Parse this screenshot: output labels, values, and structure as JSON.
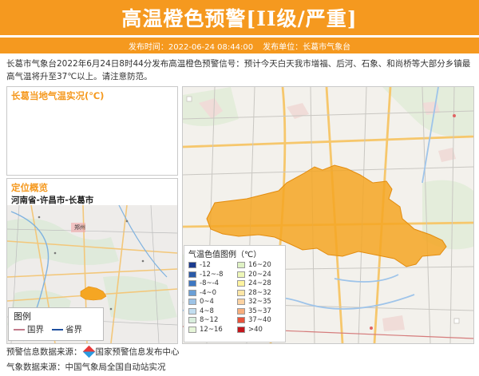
{
  "header": {
    "title": "高温橙色预警[II级/严重]",
    "publish_time_label": "发布时间：",
    "publish_time": "2022-06-24 08:44:00",
    "publish_unit_label": "发布单位：",
    "publish_unit": "长葛市气象台"
  },
  "warning_text": "长葛市气象台2022年6月24日8时44分发布高温橙色预警信号：预计今天白天我市增福、后河、石象、和尚桥等大部分乡镇最高气温将升至37℃以上。请注意防范。",
  "temp_panel": {
    "title": "长葛当地气温实况(℃)"
  },
  "location_panel": {
    "title": "定位概览",
    "path": "河南省-许昌市-长葛市"
  },
  "small_legend": {
    "title": "图例",
    "items": [
      {
        "label": "国界",
        "color": "#c27a8a"
      },
      {
        "label": "省界",
        "color": "#1f4fa0"
      }
    ]
  },
  "color_legend": {
    "title": "气温色值图例（℃）",
    "items": [
      {
        "label": "-12",
        "color": "#1a3b8f"
      },
      {
        "label": "16~20",
        "color": "#dff2c4"
      },
      {
        "label": "-12~-8",
        "color": "#2a5aa8"
      },
      {
        "label": "20~24",
        "color": "#eef7b8"
      },
      {
        "label": "-8~-4",
        "color": "#3d77c2"
      },
      {
        "label": "24~28",
        "color": "#fff4a0"
      },
      {
        "label": "-4~0",
        "color": "#6a9fd6"
      },
      {
        "label": "28~32",
        "color": "#fde6a6"
      },
      {
        "label": "0~4",
        "color": "#9dc3e6"
      },
      {
        "label": "32~35",
        "color": "#fcd2a2"
      },
      {
        "label": "4~8",
        "color": "#c2def0"
      },
      {
        "label": "35~37",
        "color": "#f7ae7d"
      },
      {
        "label": "8~12",
        "color": "#d9eedd"
      },
      {
        "label": "37~40",
        "color": "#e8533b"
      },
      {
        "label": "12~16",
        "color": "#e6f5d8"
      },
      {
        "label": ">40",
        "color": "#c4161c"
      }
    ]
  },
  "footer": {
    "source1_label": "预警信息数据来源：",
    "source1": "国家预警信息发布中心",
    "source2_label": "气象数据来源：",
    "source2": "中国气象局全国自动站实况"
  },
  "map_labels": {
    "zhengzhou": "郑州"
  },
  "colors": {
    "accent": "#f5991f",
    "region_fill": "#f5a623"
  }
}
